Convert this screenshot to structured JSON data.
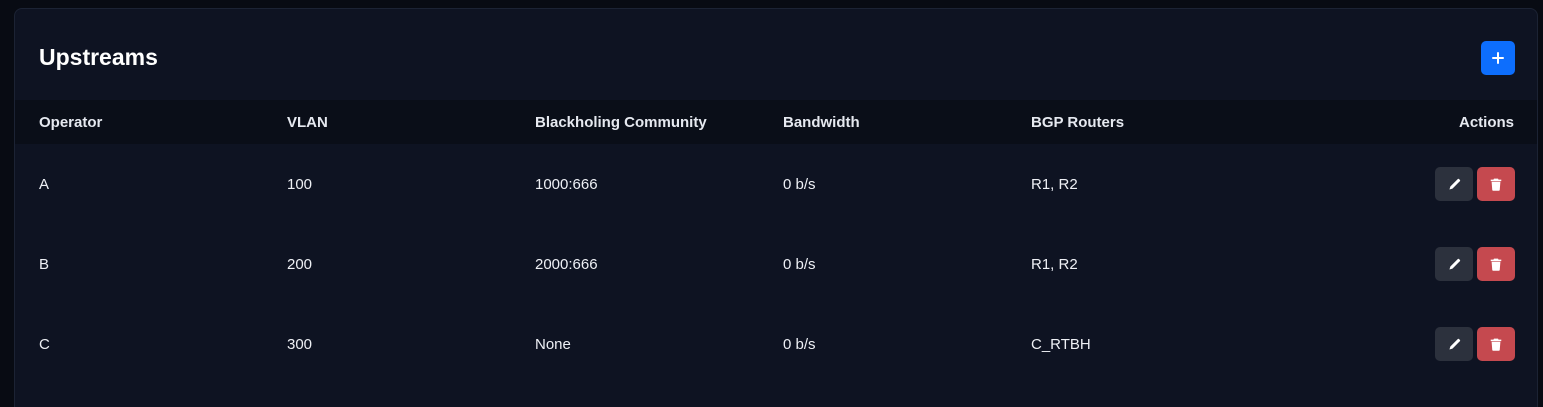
{
  "card": {
    "title": "Upstreams",
    "add_icon": "plus-icon"
  },
  "table": {
    "headers": {
      "operator": "Operator",
      "vlan": "VLAN",
      "community": "Blackholing Community",
      "bandwidth": "Bandwidth",
      "routers": "BGP Routers",
      "actions": "Actions"
    },
    "rows": [
      {
        "operator": "A",
        "vlan": "100",
        "community": "1000:666",
        "bandwidth": "0 b/s",
        "routers": "R1, R2"
      },
      {
        "operator": "B",
        "vlan": "200",
        "community": "2000:666",
        "bandwidth": "0 b/s",
        "routers": "R1, R2"
      },
      {
        "operator": "C",
        "vlan": "300",
        "community": "None",
        "bandwidth": "0 b/s",
        "routers": "C_RTBH"
      }
    ],
    "row_icons": {
      "edit": "pencil-icon",
      "delete": "trash-icon"
    }
  },
  "colors": {
    "background": "#080b13",
    "card": "#0e1322",
    "header_row": "#0a0e18",
    "primary": "#0d6efd",
    "edit": "#2c313d",
    "danger": "#c5494f"
  }
}
